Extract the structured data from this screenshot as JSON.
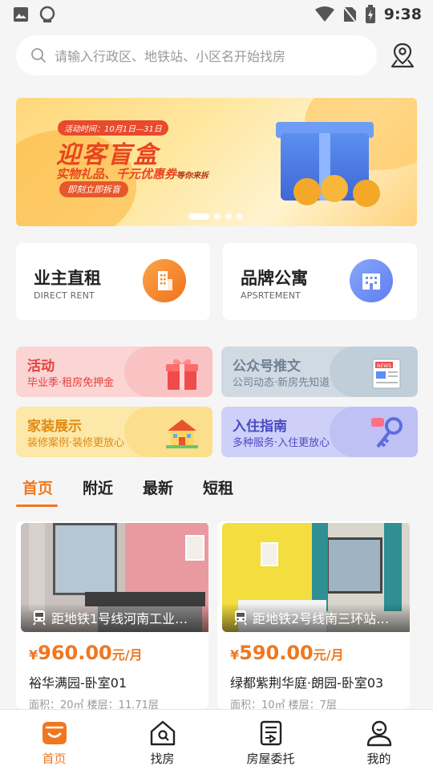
{
  "status_bar": {
    "time": "9:38"
  },
  "search": {
    "placeholder": "请输入行政区、地铁站、小区名开始找房"
  },
  "banner": {
    "tag": "活动时间：10月1日—31日",
    "title": "迎客盲盒",
    "subtitle": "实物礼品、千元优惠券",
    "subtitle_small": "等你来拆",
    "button": "即刻立即拆盲",
    "page_count": 4,
    "active_page": 0
  },
  "cards": [
    {
      "title": "业主直租",
      "subtitle": "DIRECT RENT",
      "icon": "building-icon",
      "color": "#f58a2a"
    },
    {
      "title": "品牌公寓",
      "subtitle": "APSRTEMENT",
      "icon": "apartment-icon",
      "color": "#6f8ff5"
    }
  ],
  "tiles": [
    {
      "title": "活动",
      "subtitle": "毕业季·租房免押金",
      "icon": "gift-icon",
      "bg": "#fbd0d0",
      "color": "#e5403c"
    },
    {
      "title": "公众号推文",
      "subtitle": "公司动态·新房先知道",
      "icon": "news-icon",
      "bg": "#cdd9e3",
      "color": "#6f8193"
    },
    {
      "title": "家装展示",
      "subtitle": "装修案例·装修更放心",
      "icon": "house-icon",
      "bg": "#fbe6a2",
      "color": "#e08a12"
    },
    {
      "title": "入住指南",
      "subtitle": "多种服务·入住更放心",
      "icon": "key-icon",
      "bg": "#cdcdf8",
      "color": "#4a4ac4"
    }
  ],
  "tabs": [
    "首页",
    "附近",
    "最新",
    "短租"
  ],
  "active_tab": 0,
  "listings": [
    {
      "metro": "距地铁1号线河南工业…",
      "currency": "¥",
      "price": "960.00",
      "unit": "元/月",
      "name": "裕华满园-卧室01",
      "meta": "面积：20㎡   楼层：11.71层"
    },
    {
      "metro": "距地铁2号线南三环站…",
      "currency": "¥",
      "price": "590.00",
      "unit": "元/月",
      "name": "绿都紫荆华庭·朗园-卧室03",
      "meta": "面积：10㎡   楼层：7层"
    }
  ],
  "bottom_nav": [
    {
      "label": "首页",
      "icon": "home-icon"
    },
    {
      "label": "找房",
      "icon": "find-house-icon"
    },
    {
      "label": "房屋委托",
      "icon": "delegate-icon"
    },
    {
      "label": "我的",
      "icon": "profile-icon"
    }
  ],
  "active_nav": 0,
  "colors": {
    "accent": "#f0771f",
    "background": "#f5f5f5"
  }
}
